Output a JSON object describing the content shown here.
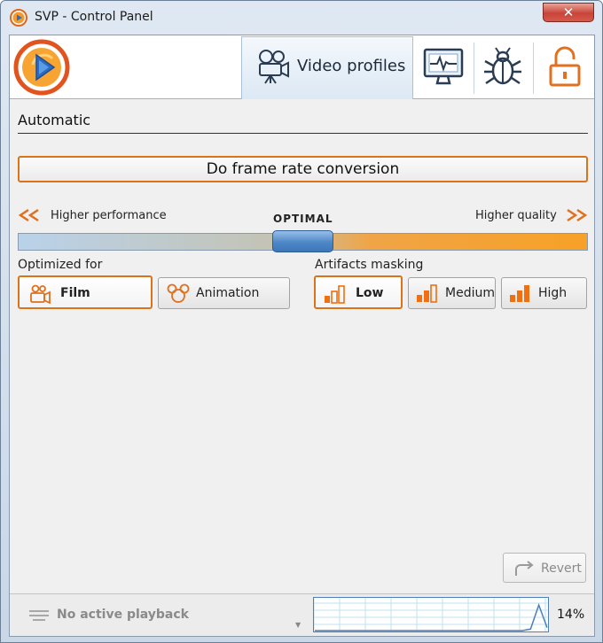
{
  "window": {
    "title": "SVP - Control Panel",
    "close_glyph": "✕"
  },
  "colors": {
    "accent_orange": "#d9741b",
    "selection_blue": "#4d87c7",
    "graph_blue": "#4e7fb8"
  },
  "header": {
    "logo_icon": "svp-logo-icon",
    "tabs": [
      {
        "label": "Video profiles",
        "icon": "film-camera-icon",
        "active": true
      },
      {
        "label": "",
        "icon": "monitor-icon",
        "active": false
      },
      {
        "label": "",
        "icon": "bug-icon",
        "active": false
      },
      {
        "label": "",
        "icon": "unlock-icon",
        "active": false
      }
    ]
  },
  "profile": {
    "name": "Automatic",
    "frame_rate_conversion_label": "Do frame rate conversion",
    "slider": {
      "left_label": "Higher performance",
      "center_label": "OPTIMAL",
      "right_label": "Higher quality",
      "value_fraction": 0.5
    }
  },
  "optimized_for": {
    "label": "Optimized for",
    "options": [
      {
        "label": "Film",
        "icon": "film-icon",
        "selected": true
      },
      {
        "label": "Animation",
        "icon": "mouse-ears-icon",
        "selected": false
      }
    ]
  },
  "artifacts_masking": {
    "label": "Artifacts masking",
    "options": [
      {
        "label": "Low",
        "icon": "bars-icon",
        "selected": true
      },
      {
        "label": "Medium",
        "icon": "bars-icon",
        "selected": false
      },
      {
        "label": "High",
        "icon": "bars-icon",
        "selected": false
      }
    ]
  },
  "revert": {
    "label": "Revert",
    "icon": "revert-arrow-icon"
  },
  "status": {
    "playback_text": "No active playback",
    "cpu_percent": "14%",
    "cpu_graph_values": [
      0,
      0,
      0,
      0,
      0,
      0,
      0,
      0,
      0,
      0,
      0,
      0,
      0,
      0,
      0,
      0,
      0,
      0,
      0,
      0,
      0,
      0,
      0,
      0,
      0,
      0,
      5,
      85,
      10
    ]
  }
}
